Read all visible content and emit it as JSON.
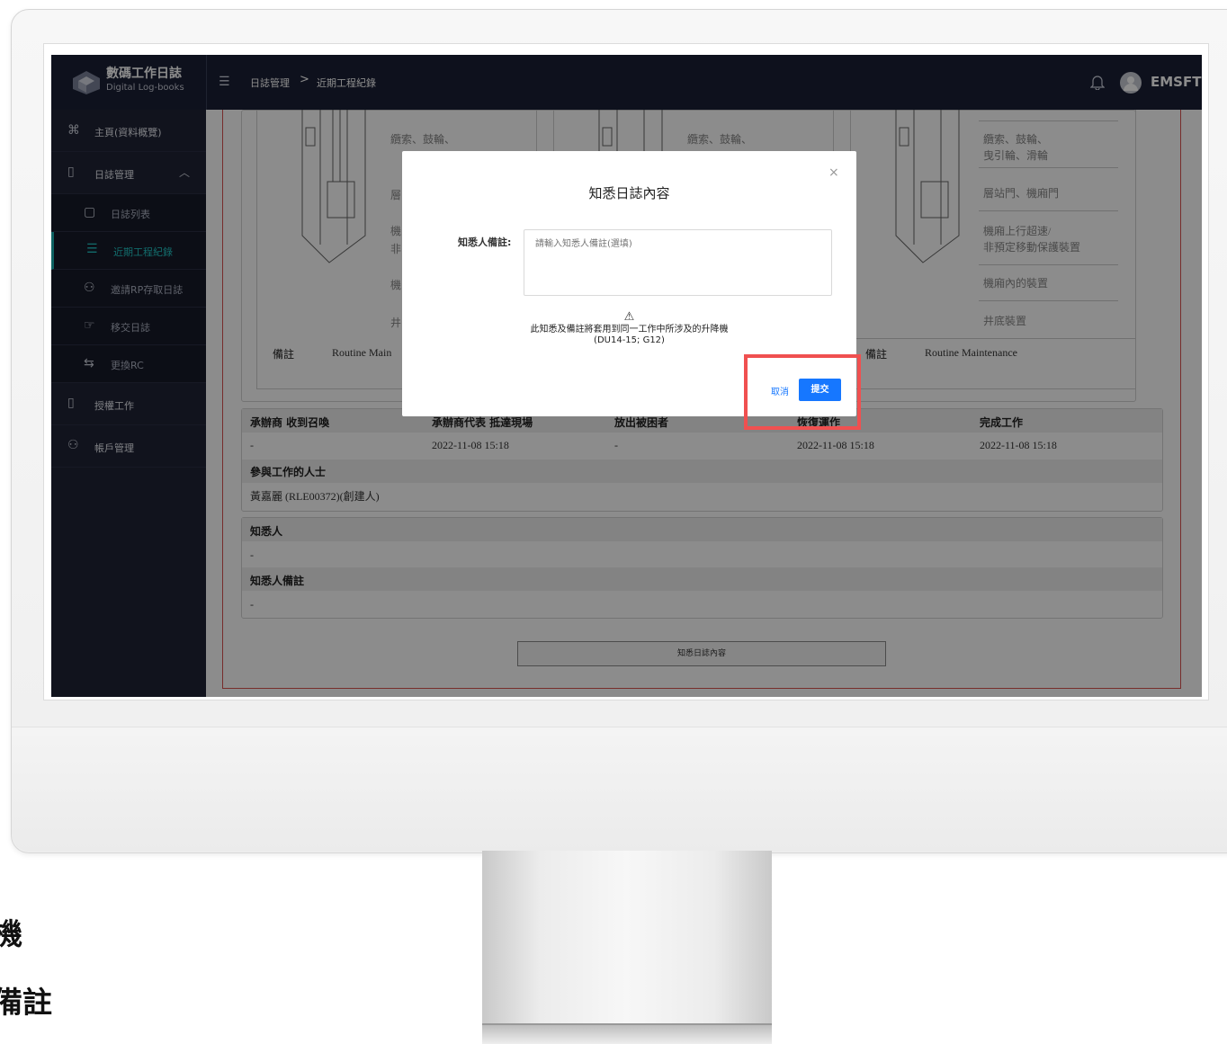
{
  "app": {
    "logo_title": "數碼工作日誌",
    "logo_subtitle": "Digital Log-books",
    "breadcrumb": [
      "日誌管理",
      "近期工程紀錄"
    ],
    "breadcrumb_separator": ">",
    "user_name": "EMSFT"
  },
  "sidebar": {
    "items": [
      {
        "label": "主頁(資料概覽)",
        "icon": "dashboard-icon"
      },
      {
        "label": "日誌管理",
        "icon": "book-icon",
        "expanded": true
      },
      {
        "label": "日誌列表",
        "icon": "document-icon"
      },
      {
        "label": "近期工程紀錄",
        "icon": "list-icon",
        "active": true
      },
      {
        "label": "邀請RP存取日誌",
        "icon": "invite-icon"
      },
      {
        "label": "移交日誌",
        "icon": "handover-icon"
      },
      {
        "label": "更換RC",
        "icon": "swap-icon"
      },
      {
        "label": "授權工作",
        "icon": "authorize-icon"
      },
      {
        "label": "帳戶管理",
        "icon": "account-icon"
      }
    ]
  },
  "background": {
    "lift_cards": [
      {
        "parts": [
          "纜索、鼓輪、",
          "層",
          "機",
          "非",
          "機",
          "井"
        ],
        "remark_label": "備註",
        "remark_value": "Routine Main"
      },
      {
        "parts": [
          "纜索、鼓輪、"
        ],
        "remark_label": "備註",
        "remark_value": ""
      },
      {
        "parts": [
          "纜索、鼓輪、",
          "曳引輪、滑輪",
          "層站門、機廂門",
          "機廂上行超速/",
          "非預定移動保護裝置",
          "機廂內的裝置",
          "井底裝置"
        ],
        "remark_label": "備註",
        "remark_value": "Routine Maintenance"
      }
    ],
    "timeline_headers": [
      "承辦商 收到召喚",
      "承辦商代表 抵達現場",
      "放出被困者",
      "恢復運作",
      "完成工作"
    ],
    "timeline_values": [
      "-",
      "2022-11-08 15:18",
      "-",
      "2022-11-08 15:18",
      "2022-11-08 15:18"
    ],
    "participants_label": "參與工作的人士",
    "participants_value": "黃嘉麗 (RLE00372)(創建人)",
    "acknowledger_label": "知悉人",
    "acknowledger_value": "-",
    "acknowledger_note_label": "知悉人備註",
    "acknowledger_note_value": "-",
    "ack_button": "知悉日誌內容"
  },
  "modal": {
    "title": "知悉日誌內容",
    "close": "×",
    "note_label": "知悉人備註:",
    "note_placeholder": "請輸入知悉人備註(選填)",
    "note_value": "",
    "warning_icon": "⚠",
    "warning_line1": "此知悉及備註將套用到同一工作中所涉及的升降機",
    "warning_line2": "(DU14-15; G12)",
    "cancel_label": "取消",
    "submit_label": "提交"
  },
  "outside": {
    "line1": "機",
    "line2": "備註"
  },
  "colors": {
    "topbar": "#1b2035",
    "sidebar": "#1f2335",
    "active": "#22c4c4",
    "primary": "#1677ff",
    "highlight": "#f05050"
  }
}
